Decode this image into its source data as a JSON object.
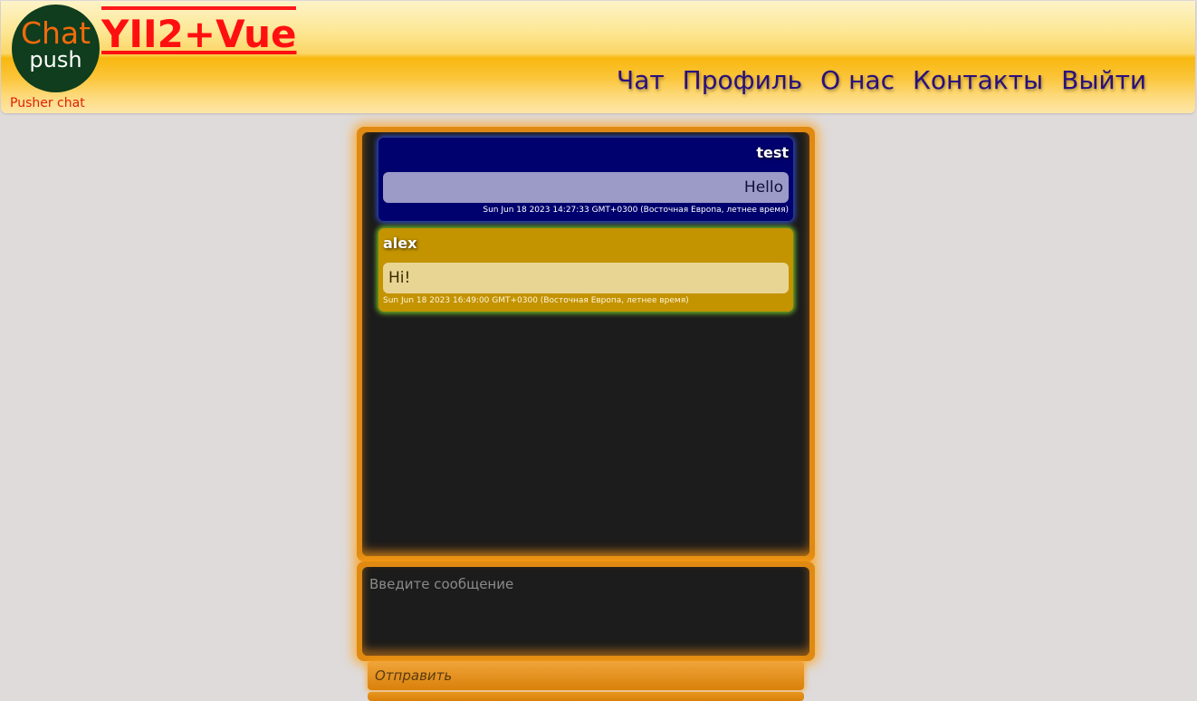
{
  "header": {
    "logo_top": "Chat",
    "logo_bottom": "push",
    "logo_subtitle": "Pusher chat",
    "brand": "YII2+Vue",
    "nav": [
      {
        "label": "Чат"
      },
      {
        "label": "Профиль"
      },
      {
        "label": "О нас"
      },
      {
        "label": "Контакты"
      },
      {
        "label": "Выйти"
      }
    ]
  },
  "chat": {
    "messages": [
      {
        "author": "test",
        "text": "Hello",
        "time": "Sun Jun 18 2023 14:27:33 GMT+0300 (Восточная Европа, летнее время)",
        "color": "#00006e"
      },
      {
        "author": "alex",
        "text": "Hi!",
        "time": "Sun Jun 18 2023 16:49:00 GMT+0300 (Восточная Европа, летнее время)",
        "color": "#c39300"
      }
    ]
  },
  "composer": {
    "placeholder": "Введите сообщение",
    "value": "",
    "send_label": "Отправить"
  },
  "colors": {
    "accent": "#e08a12",
    "nav_text": "#2a0f7c",
    "brand": "#ff1010",
    "chat_background": "#1c1c1c",
    "page_background": "#dfdbdb"
  }
}
